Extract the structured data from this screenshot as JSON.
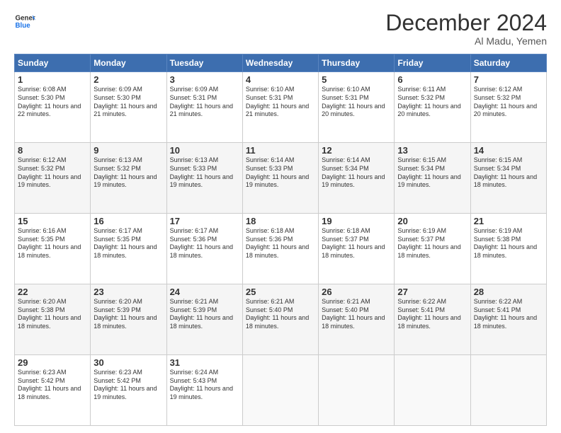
{
  "header": {
    "logo_line1": "General",
    "logo_line2": "Blue",
    "month": "December 2024",
    "location": "Al Madu, Yemen"
  },
  "weekdays": [
    "Sunday",
    "Monday",
    "Tuesday",
    "Wednesday",
    "Thursday",
    "Friday",
    "Saturday"
  ],
  "weeks": [
    [
      {
        "day": "1",
        "sunrise": "6:08 AM",
        "sunset": "5:30 PM",
        "daylight": "11 hours and 22 minutes."
      },
      {
        "day": "2",
        "sunrise": "6:09 AM",
        "sunset": "5:30 PM",
        "daylight": "11 hours and 21 minutes."
      },
      {
        "day": "3",
        "sunrise": "6:09 AM",
        "sunset": "5:31 PM",
        "daylight": "11 hours and 21 minutes."
      },
      {
        "day": "4",
        "sunrise": "6:10 AM",
        "sunset": "5:31 PM",
        "daylight": "11 hours and 21 minutes."
      },
      {
        "day": "5",
        "sunrise": "6:10 AM",
        "sunset": "5:31 PM",
        "daylight": "11 hours and 20 minutes."
      },
      {
        "day": "6",
        "sunrise": "6:11 AM",
        "sunset": "5:32 PM",
        "daylight": "11 hours and 20 minutes."
      },
      {
        "day": "7",
        "sunrise": "6:12 AM",
        "sunset": "5:32 PM",
        "daylight": "11 hours and 20 minutes."
      }
    ],
    [
      {
        "day": "8",
        "sunrise": "6:12 AM",
        "sunset": "5:32 PM",
        "daylight": "11 hours and 19 minutes."
      },
      {
        "day": "9",
        "sunrise": "6:13 AM",
        "sunset": "5:32 PM",
        "daylight": "11 hours and 19 minutes."
      },
      {
        "day": "10",
        "sunrise": "6:13 AM",
        "sunset": "5:33 PM",
        "daylight": "11 hours and 19 minutes."
      },
      {
        "day": "11",
        "sunrise": "6:14 AM",
        "sunset": "5:33 PM",
        "daylight": "11 hours and 19 minutes."
      },
      {
        "day": "12",
        "sunrise": "6:14 AM",
        "sunset": "5:34 PM",
        "daylight": "11 hours and 19 minutes."
      },
      {
        "day": "13",
        "sunrise": "6:15 AM",
        "sunset": "5:34 PM",
        "daylight": "11 hours and 19 minutes."
      },
      {
        "day": "14",
        "sunrise": "6:15 AM",
        "sunset": "5:34 PM",
        "daylight": "11 hours and 18 minutes."
      }
    ],
    [
      {
        "day": "15",
        "sunrise": "6:16 AM",
        "sunset": "5:35 PM",
        "daylight": "11 hours and 18 minutes."
      },
      {
        "day": "16",
        "sunrise": "6:17 AM",
        "sunset": "5:35 PM",
        "daylight": "11 hours and 18 minutes."
      },
      {
        "day": "17",
        "sunrise": "6:17 AM",
        "sunset": "5:36 PM",
        "daylight": "11 hours and 18 minutes."
      },
      {
        "day": "18",
        "sunrise": "6:18 AM",
        "sunset": "5:36 PM",
        "daylight": "11 hours and 18 minutes."
      },
      {
        "day": "19",
        "sunrise": "6:18 AM",
        "sunset": "5:37 PM",
        "daylight": "11 hours and 18 minutes."
      },
      {
        "day": "20",
        "sunrise": "6:19 AM",
        "sunset": "5:37 PM",
        "daylight": "11 hours and 18 minutes."
      },
      {
        "day": "21",
        "sunrise": "6:19 AM",
        "sunset": "5:38 PM",
        "daylight": "11 hours and 18 minutes."
      }
    ],
    [
      {
        "day": "22",
        "sunrise": "6:20 AM",
        "sunset": "5:38 PM",
        "daylight": "11 hours and 18 minutes."
      },
      {
        "day": "23",
        "sunrise": "6:20 AM",
        "sunset": "5:39 PM",
        "daylight": "11 hours and 18 minutes."
      },
      {
        "day": "24",
        "sunrise": "6:21 AM",
        "sunset": "5:39 PM",
        "daylight": "11 hours and 18 minutes."
      },
      {
        "day": "25",
        "sunrise": "6:21 AM",
        "sunset": "5:40 PM",
        "daylight": "11 hours and 18 minutes."
      },
      {
        "day": "26",
        "sunrise": "6:21 AM",
        "sunset": "5:40 PM",
        "daylight": "11 hours and 18 minutes."
      },
      {
        "day": "27",
        "sunrise": "6:22 AM",
        "sunset": "5:41 PM",
        "daylight": "11 hours and 18 minutes."
      },
      {
        "day": "28",
        "sunrise": "6:22 AM",
        "sunset": "5:41 PM",
        "daylight": "11 hours and 18 minutes."
      }
    ],
    [
      {
        "day": "29",
        "sunrise": "6:23 AM",
        "sunset": "5:42 PM",
        "daylight": "11 hours and 18 minutes."
      },
      {
        "day": "30",
        "sunrise": "6:23 AM",
        "sunset": "5:42 PM",
        "daylight": "11 hours and 19 minutes."
      },
      {
        "day": "31",
        "sunrise": "6:24 AM",
        "sunset": "5:43 PM",
        "daylight": "11 hours and 19 minutes."
      },
      null,
      null,
      null,
      null
    ]
  ]
}
